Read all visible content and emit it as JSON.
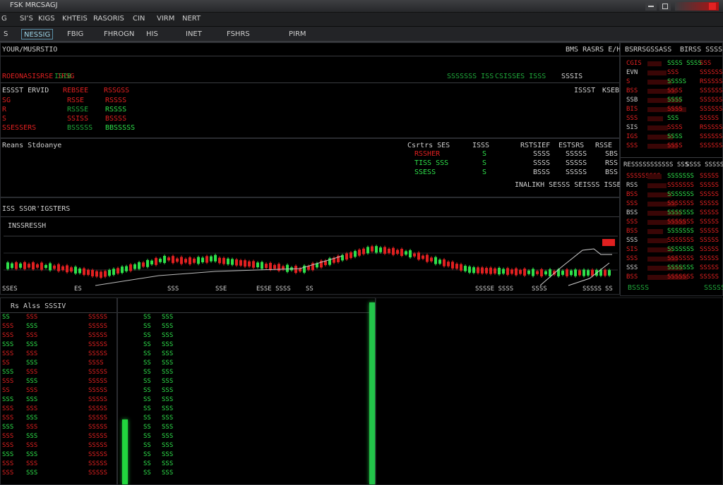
{
  "window": {
    "title": "FSK MRCSAGJ"
  },
  "menu": [
    "SI’S",
    "KIGS",
    "KHTEIS",
    "RASORIS",
    "CIN",
    "VIRM",
    "NERT"
  ],
  "toolbar": {
    "items": [
      "S",
      "NESSIG",
      "FBIG",
      "FHROGN",
      "HIS",
      "INET",
      "FSHRS",
      "PIRM"
    ]
  },
  "top_panel": {
    "title": "YOUR/MUSRSTIO",
    "right_title": "BMS RASRS E/HE",
    "left_red": "ROEONASISRSE IRSG",
    "left_green": "ISIB",
    "mid_green": [
      "SSSSSSS ISS",
      "CSISSES ISSS"
    ],
    "mid_white": "SSSIS",
    "col_heads": [
      "ESSST ERVID",
      "REBSEE",
      "RSSGSS"
    ],
    "col_heads2": [
      "ISSST",
      "KSEB"
    ],
    "rows": [
      {
        "a": "SG",
        "b": "RSSE",
        "c": "RSSSS"
      },
      {
        "a": "R",
        "b": "RSSSE",
        "c": "RSSSS"
      },
      {
        "a": "S",
        "b": "SSISS",
        "c": "BSSSS"
      },
      {
        "a": "SSESSERS",
        "b": "BSSSSS",
        "c": "BBSSSSS"
      }
    ]
  },
  "sub_panel": {
    "title": "Reans Stdoanye",
    "heads": [
      "Csrtrs SES",
      "ISSS",
      "RSTSIEF",
      "ESTSRS",
      "RSSE"
    ],
    "rows": [
      {
        "a": "RSSHER",
        "b": "S",
        "c": "SSSS",
        "d": "SSSSS",
        "e": "SBS"
      },
      {
        "a": "TISS SSS",
        "b": "S",
        "c": "SSSS",
        "d": "SSSSS",
        "e": "RSS"
      },
      {
        "a": "SSESS",
        "b": "S",
        "c": "BSSS",
        "d": "SSSSS",
        "e": "BSS"
      }
    ],
    "footer": "INALIKH SESSS SEISSS ISSES"
  },
  "chart_panel": {
    "title": "ISS SSOR'IGSTERS",
    "inner_label": "INSSRESSH",
    "xlabels": [
      "SSES",
      "ES",
      "SSS",
      "SSE",
      "ESSE SSSS",
      "SS",
      "SSSSE SSSS",
      "SSSS",
      "SSSSS",
      "SS"
    ]
  },
  "right_panel": {
    "title1": "BSRRSGSSASS",
    "title2": "BIRSS SSSSS",
    "rows1": [
      {
        "a": "CGIS",
        "b": "SSSS SSSS",
        "c": "SSS"
      },
      {
        "a": "EVN",
        "b": "SSS",
        "c": "SSSSSS"
      },
      {
        "a": "S",
        "b": "SSSSS",
        "c": "RSSSSS"
      },
      {
        "a": "BSS",
        "b": "SSSS",
        "c": "SSSSSS"
      },
      {
        "a": "SSB",
        "b": "SSSS",
        "c": "SSSSSS"
      },
      {
        "a": "BIS",
        "b": "SSSS",
        "c": "SSSSSS"
      },
      {
        "a": "SSS",
        "b": "SSS",
        "c": "SSSSS"
      },
      {
        "a": "SIS",
        "b": "SSSS",
        "c": "RSSSSS"
      },
      {
        "a": "IGS",
        "b": "SSSS",
        "c": "SSSSSS"
      },
      {
        "a": "SSS",
        "b": "SSSS",
        "c": "SSSSSS"
      }
    ],
    "title3": "RESSSSSSSSSSS SSS",
    "title4": "SSSS SSSSS",
    "rows2": [
      {
        "a": "SSSSSSSSS",
        "b": "SSSSSSS",
        "c": "SSSSS"
      },
      {
        "a": "RSS",
        "b": "SSSSSSS",
        "c": "SSSSS"
      },
      {
        "a": "BSS",
        "b": "SSSSSSS",
        "c": "SSSSS"
      },
      {
        "a": "SSS",
        "b": "SSSSSSS",
        "c": "SSSSS"
      },
      {
        "a": "BSS",
        "b": "SSSSSSS",
        "c": "SSSSS"
      },
      {
        "a": "SSS",
        "b": "SSSSSSS",
        "c": "SSSSS"
      },
      {
        "a": "BSS",
        "b": "SSSSSSS",
        "c": "SSSSS"
      },
      {
        "a": "SSS",
        "b": "SSSSSSS",
        "c": "SSSSS"
      },
      {
        "a": "SIS",
        "b": "SSSSSSS",
        "c": "SSSSS"
      },
      {
        "a": "SSS",
        "b": "SSSSSSS",
        "c": "SSSSS"
      },
      {
        "a": "SSS",
        "b": "SSSSSSS",
        "c": "SSSSS"
      },
      {
        "a": "BSS",
        "b": "SSSSSSS",
        "c": "SSSSS"
      }
    ],
    "footer_left": "BSSSS",
    "footer_right": "SSSSSV"
  },
  "bottom_left": {
    "title": "Rs Alss SSSIV",
    "rows": [
      {
        "a": "SS",
        "b": "SSS",
        "c": "SSSSS"
      },
      {
        "a": "SSS",
        "b": "SSS",
        "c": "SSSSS"
      },
      {
        "a": "SSS",
        "b": "SSS",
        "c": "SSSSS"
      },
      {
        "a": "SSS",
        "b": "SSS",
        "c": "SSSSS"
      },
      {
        "a": "SSS",
        "b": "SSS",
        "c": "SSSSS"
      },
      {
        "a": "SS",
        "b": "SSS",
        "c": "SSSS"
      },
      {
        "a": "SSS",
        "b": "SSS",
        "c": "SSSSS"
      },
      {
        "a": "SSS",
        "b": "SSS",
        "c": "SSSSS"
      },
      {
        "a": "SS",
        "b": "SSS",
        "c": "SSSSS"
      },
      {
        "a": "SSS",
        "b": "SSS",
        "c": "SSSSS"
      },
      {
        "a": "SSS",
        "b": "SSS",
        "c": "SSSSS"
      },
      {
        "a": "SSS",
        "b": "SSS",
        "c": "SSSSS"
      },
      {
        "a": "SSS",
        "b": "SSS",
        "c": "SSSSS"
      },
      {
        "a": "SSS",
        "b": "SSS",
        "c": "SSSSS"
      },
      {
        "a": "SSS",
        "b": "SSS",
        "c": "SSSSS"
      },
      {
        "a": "SSS",
        "b": "SSS",
        "c": "SSSSS"
      },
      {
        "a": "SSS",
        "b": "SSS",
        "c": "SSSSS"
      },
      {
        "a": "SSS",
        "b": "SSS",
        "c": "SSSSS"
      }
    ]
  },
  "bottom_mid": {
    "rows": [
      {
        "a": "SS",
        "b": "SSS"
      },
      {
        "a": "SS",
        "b": "SSS"
      },
      {
        "a": "SS",
        "b": "SSS"
      },
      {
        "a": "SS",
        "b": "SSS"
      },
      {
        "a": "SS",
        "b": "SSS"
      },
      {
        "a": "SS",
        "b": "SSS"
      },
      {
        "a": "SS",
        "b": "SSS"
      },
      {
        "a": "SS",
        "b": "SSS"
      },
      {
        "a": "SS",
        "b": "SSS"
      },
      {
        "a": "SS",
        "b": "SSS"
      },
      {
        "a": "SS",
        "b": "SSS"
      },
      {
        "a": "SS",
        "b": "SSS"
      },
      {
        "a": "SS",
        "b": "SSS"
      },
      {
        "a": "SS",
        "b": "SSS"
      },
      {
        "a": "SS",
        "b": "SSS"
      },
      {
        "a": "SS",
        "b": "SSS"
      },
      {
        "a": "SS",
        "b": "SSS"
      },
      {
        "a": "SS",
        "b": "SSS"
      }
    ]
  },
  "colors": {
    "up": "#2ee04a",
    "down": "#e02020",
    "bg": "#000000",
    "panel_border": "#2a2c30"
  }
}
